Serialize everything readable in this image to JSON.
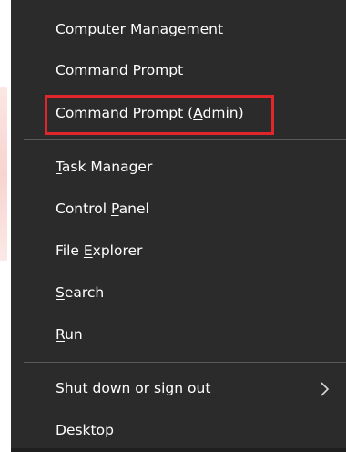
{
  "menu": {
    "items": [
      {
        "before": "Computer Management",
        "key": "",
        "after": ""
      },
      {
        "before": "",
        "key": "C",
        "after": "ommand Prompt"
      },
      {
        "before": "Command Prompt (",
        "key": "A",
        "after": "dmin)"
      },
      {
        "before": "",
        "key": "T",
        "after": "ask Manager"
      },
      {
        "before": "Control ",
        "key": "P",
        "after": "anel"
      },
      {
        "before": "File ",
        "key": "E",
        "after": "xplorer"
      },
      {
        "before": "",
        "key": "S",
        "after": "earch"
      },
      {
        "before": "",
        "key": "R",
        "after": "un"
      },
      {
        "before": "Sh",
        "key": "u",
        "after": "t down or sign out"
      },
      {
        "before": "",
        "key": "D",
        "after": "esktop"
      }
    ],
    "highlighted_item": "Command Prompt (Admin)",
    "highlight_color": "#e0262c",
    "background_color": "#2b2b2b",
    "text_color": "#ffffff",
    "submenu_icon": "chevron-right-icon"
  }
}
